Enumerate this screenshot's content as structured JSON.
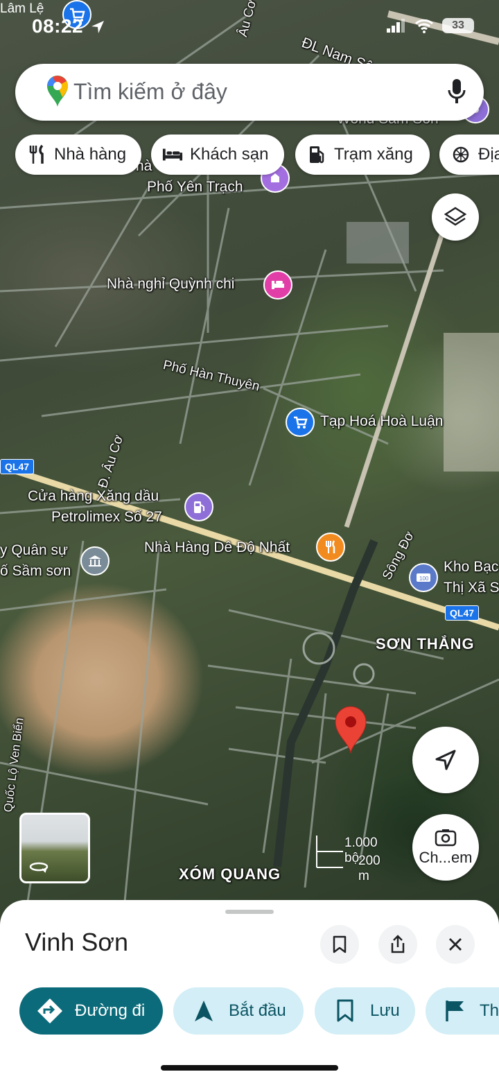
{
  "status_bar": {
    "carrier_label": "Lâm Lệ",
    "time": "08:22",
    "battery": "33"
  },
  "search": {
    "placeholder": "Tìm kiếm ở đây"
  },
  "chips": [
    {
      "label": "Nhà hàng",
      "icon": "fork-knife-icon"
    },
    {
      "label": "Khách sạn",
      "icon": "bed-icon"
    },
    {
      "label": "Trạm xăng",
      "icon": "gas-pump-icon"
    },
    {
      "label": "Địa",
      "icon": "attraction-icon"
    }
  ],
  "map": {
    "roads": {
      "dl_nam_song_ma": "ĐL Nam Sông Mã",
      "au_co_top": "Âu Cơ",
      "au_co": "Đ. Âu Cơ",
      "han_thuyen": "Phố Hàn Thuyên",
      "ql47_left": "QL47",
      "ql47_right": "QL47",
      "ven_bien": "Quốc Lộ Ven Biển",
      "song_do": "Sông Đơ"
    },
    "places": {
      "world_sam_son": "World Sam Son",
      "nha_fragment": "hà",
      "yen_trach": "Phố Yên Trạch",
      "quynh_chi": "Nhà nghỉ Quỳnh chi",
      "hoa_luan": "Tạp Hoá Hoà Luận",
      "petrolimex_1": "Cửa hàng Xăng dầu",
      "petrolimex_2": "Petrolimex Số 27",
      "quan_su_1": "y Quân sự",
      "quan_su_2": "ố Sầm sơn",
      "de_de_nhat": "Nhà Hàng Dê Độ Nhất",
      "kho_bac_1": "Kho Bạc",
      "kho_bac_2": "Thị Xã S",
      "son_thang": "SƠN THẮNG",
      "xom_quang": "XÓM QUANG"
    },
    "scale": {
      "imperial": "1.000 bộ",
      "metric": "200 m"
    }
  },
  "buttons": {
    "layers": "layers-icon",
    "locate": "navigation-arrow-icon",
    "camera_label": "Ch...em"
  },
  "sheet": {
    "title": "Vinh Sơn",
    "actions": [
      {
        "label": "Đường đi",
        "icon": "directions-icon"
      },
      {
        "label": "Bắt đầu",
        "icon": "navigation-icon"
      },
      {
        "label": "Lưu",
        "icon": "bookmark-icon"
      },
      {
        "label": "Th",
        "icon": "flag-icon"
      }
    ]
  },
  "colors": {
    "primary_teal": "#0b6b7a",
    "secondary_pill": "#d3eef6",
    "google_blue": "#1a73e8",
    "pin_red": "#d93025"
  }
}
